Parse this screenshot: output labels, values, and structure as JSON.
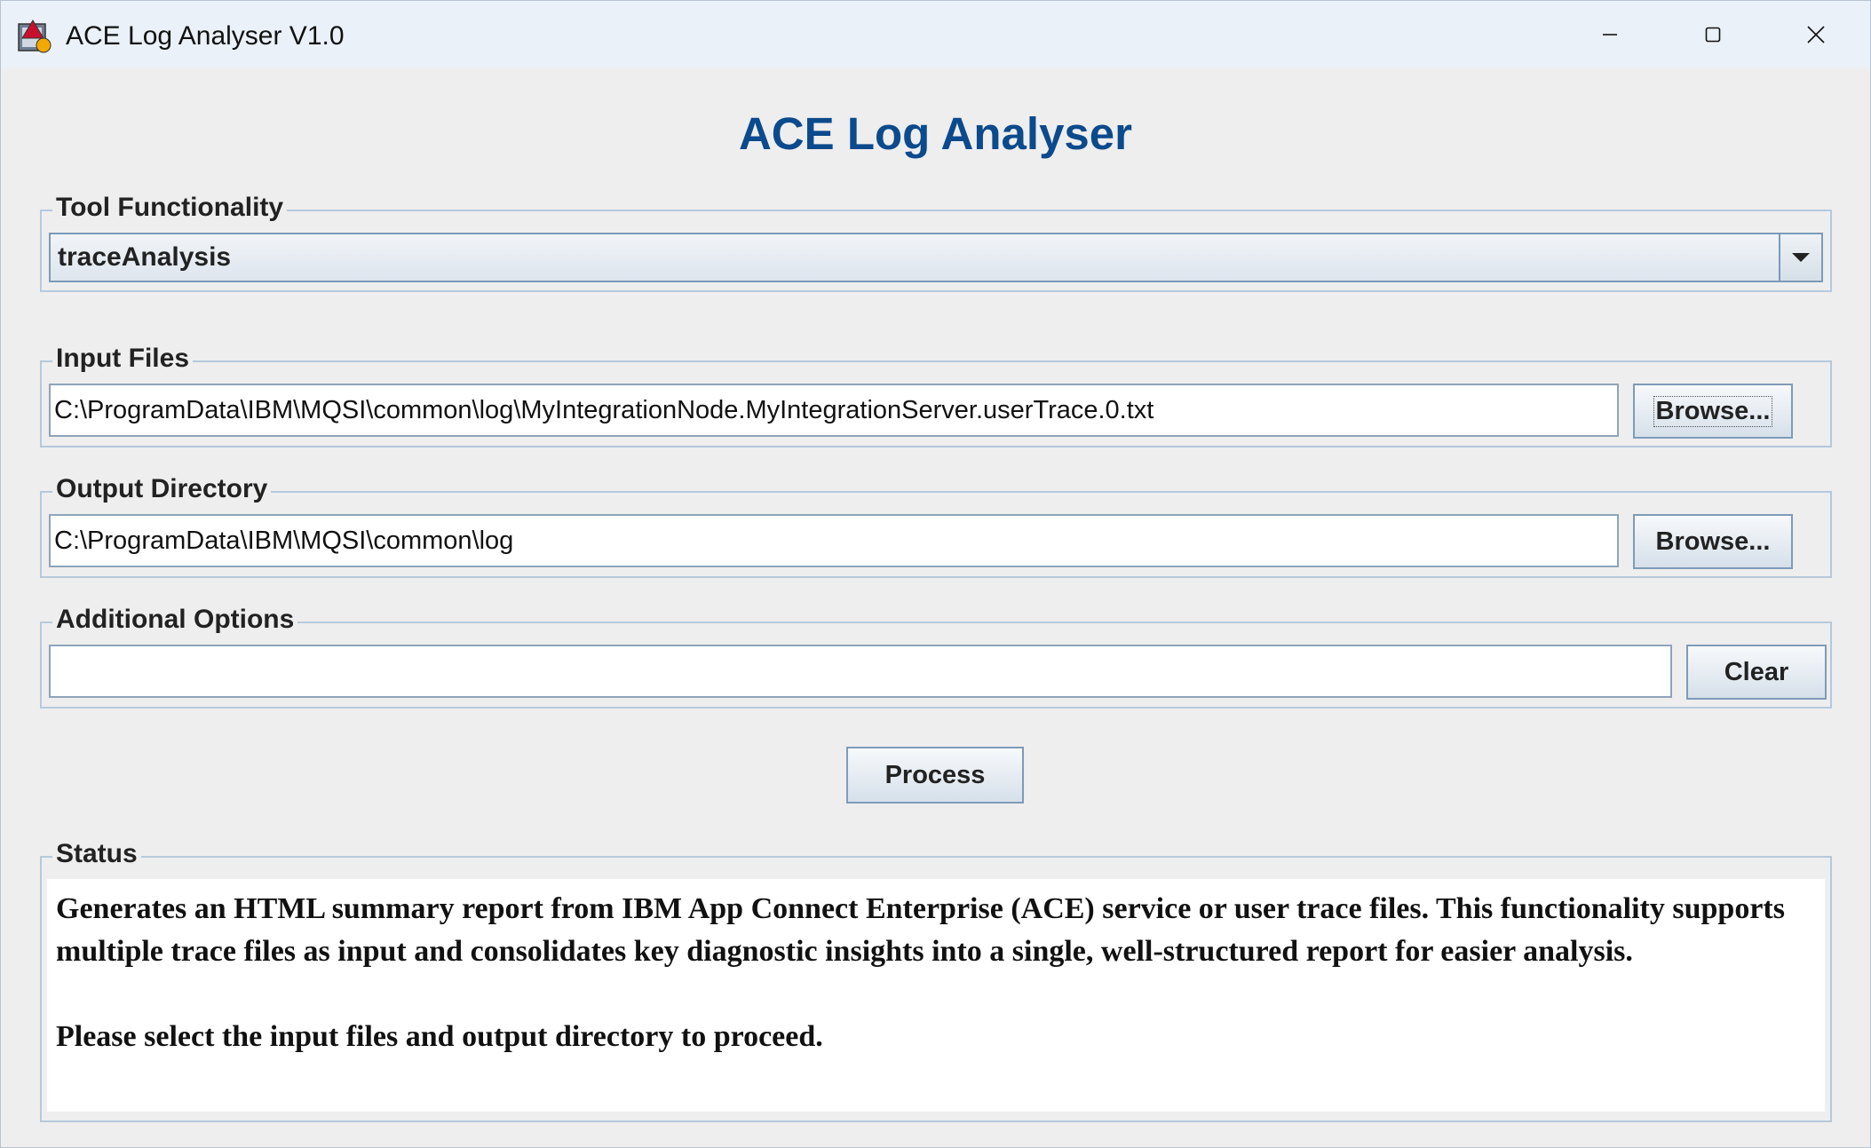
{
  "window": {
    "title": "ACE Log Analyser V1.0",
    "icon": "java-app-icon"
  },
  "heading": "ACE Log Analyser",
  "tool_functionality": {
    "label": "Tool Functionality",
    "selected": "traceAnalysis"
  },
  "input_files": {
    "label": "Input Files",
    "value": "C:\\ProgramData\\IBM\\MQSI\\common\\log\\MyIntegrationNode.MyIntegrationServer.userTrace.0.txt",
    "browse_label": "Browse..."
  },
  "output_directory": {
    "label": "Output Directory",
    "value": "C:\\ProgramData\\IBM\\MQSI\\common\\log",
    "browse_label": "Browse..."
  },
  "additional_options": {
    "label": "Additional Options",
    "value": "",
    "clear_label": "Clear"
  },
  "process_label": "Process",
  "status": {
    "label": "Status",
    "line1": "Generates an HTML summary report from IBM App Connect Enterprise (ACE) service or user trace files. This functionality supports multiple trace files as input and consolidates key diagnostic insights into a single, well-structured report for easier analysis.",
    "line2": "Please select the input files and output directory to proceed."
  },
  "colors": {
    "heading": "#0b4a8c",
    "titlebar": "#eaf1f8",
    "panel": "#eeeeee",
    "border": "#b5c9dd"
  }
}
